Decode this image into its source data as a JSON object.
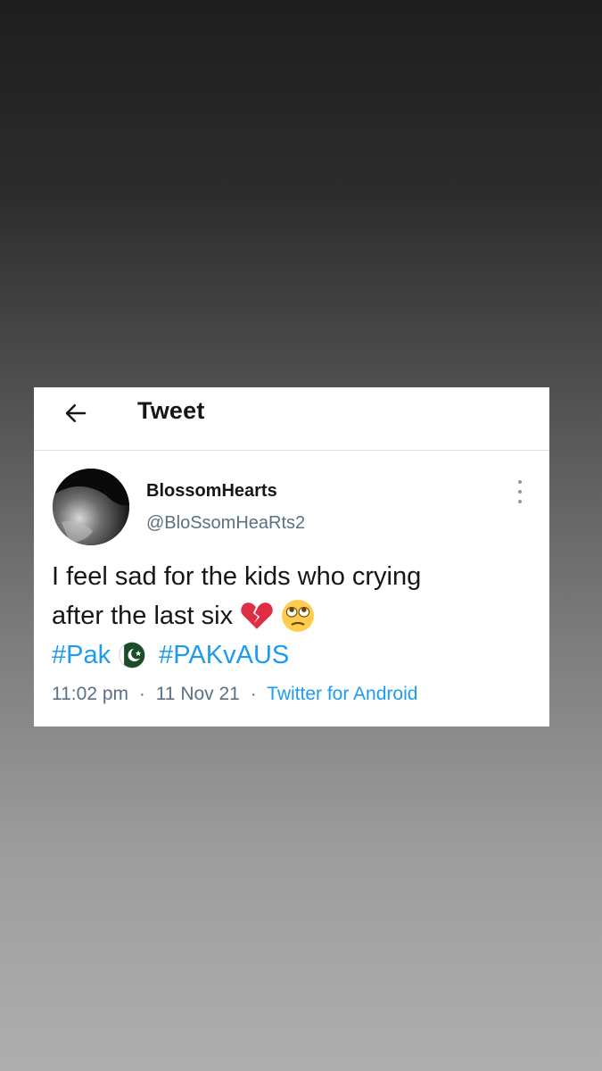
{
  "header": {
    "title": "Tweet",
    "back_icon": "arrow-left-icon"
  },
  "tweet": {
    "author": {
      "display_name": "BlossomHearts",
      "handle": "@BloSsomHeaRts2"
    },
    "text_line1": "I feel sad for the kids who crying",
    "text_line2": "after the last six",
    "emojis": [
      "broken-heart-icon",
      "face-with-rolling-eyes-icon"
    ],
    "hashtags": [
      "#Pak",
      "#PAKvAUS"
    ],
    "flag_icon": "pakistan-flag-icon",
    "time": "11:02 pm",
    "date": "11 Nov 21",
    "separator": "·",
    "source": "Twitter for Android"
  },
  "colors": {
    "link": "#1d9bf0",
    "text": "#14171a",
    "muted": "#5b7083"
  }
}
